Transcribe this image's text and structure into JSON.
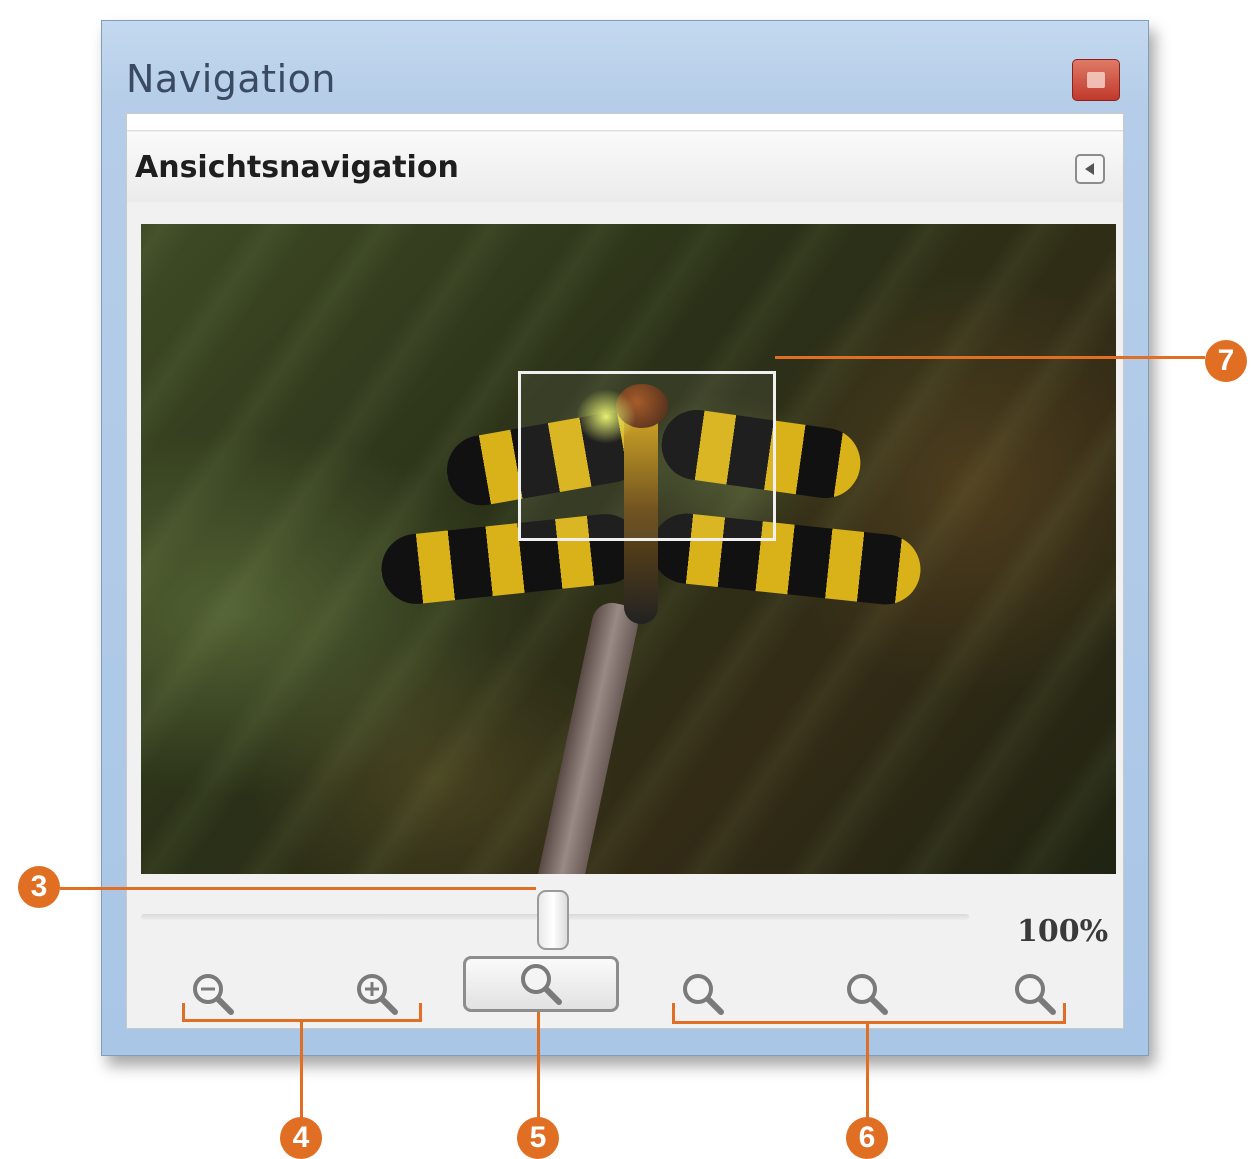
{
  "window": {
    "title": "Navigation",
    "panel_title": "Ansichtsnavigation"
  },
  "zoom": {
    "value_label": "100%"
  },
  "annotations": [
    "3",
    "4",
    "5",
    "6",
    "7"
  ],
  "icons": {
    "close": "close-icon",
    "panel_menu": "panel-menu-icon",
    "zoom_out": "zoom-out-icon",
    "zoom_in": "zoom-in-icon",
    "zoom": "magnifier-icon"
  },
  "colors": {
    "annotation": "#e06f23",
    "titlebar": "#b5cde8",
    "close_button": "#c0392b"
  }
}
